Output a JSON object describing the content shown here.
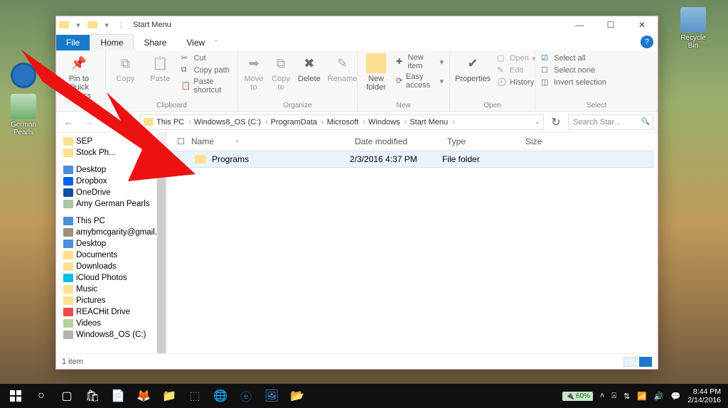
{
  "desktop": {
    "recycle": "Recycle Bin",
    "german_pearls": "German Pearls"
  },
  "window": {
    "title": "Start Menu",
    "tabs": {
      "file": "File",
      "home": "Home",
      "share": "Share",
      "view": "View"
    },
    "ribbon": {
      "pin": "Pin to Quick access",
      "copy": "Copy",
      "paste": "Paste",
      "cut": "Cut",
      "copypath": "Copy path",
      "pasteshort": "Paste shortcut",
      "clipboard": "Clipboard",
      "moveto": "Move to",
      "copyto": "Copy to",
      "delete": "Delete",
      "rename": "Rename",
      "organize": "Organize",
      "newfolder": "New folder",
      "newitem": "New item",
      "easyaccess": "Easy access",
      "new": "New",
      "properties": "Properties",
      "open": "Open",
      "edit": "Edit",
      "history": "History",
      "opengrp": "Open",
      "selectall": "Select all",
      "selectnone": "Select none",
      "invert": "Invert selection",
      "select": "Select"
    },
    "breadcrumbs": [
      "This PC",
      "Windows8_OS (C:)",
      "ProgramData",
      "Microsoft",
      "Windows",
      "Start Menu"
    ],
    "refresh_hint": "↻",
    "search_placeholder": "Search Star...",
    "columns": {
      "name": "Name",
      "date": "Date modified",
      "type": "Type",
      "size": "Size"
    },
    "rows": [
      {
        "name": "Programs",
        "date": "2/3/2016 4:37 PM",
        "type": "File folder",
        "size": ""
      }
    ],
    "status": "1 item"
  },
  "tree": [
    {
      "cls": "fld",
      "ind": 1,
      "label": "SEP"
    },
    {
      "cls": "fld",
      "ind": 1,
      "label": "Stock Ph..."
    },
    {
      "cls": "pc",
      "ind": 0,
      "label": "Desktop"
    },
    {
      "cls": "db",
      "ind": 1,
      "label": "Dropbox"
    },
    {
      "cls": "od",
      "ind": 1,
      "label": "OneDrive"
    },
    {
      "cls": "user",
      "ind": 1,
      "label": "Amy German Pearls"
    },
    {
      "cls": "pc",
      "ind": 1,
      "label": "This PC"
    },
    {
      "cls": "mail",
      "ind": 2,
      "label": "amybmcgarity@gmail.com"
    },
    {
      "cls": "pc",
      "ind": 2,
      "label": "Desktop"
    },
    {
      "cls": "fld",
      "ind": 2,
      "label": "Documents"
    },
    {
      "cls": "fld",
      "ind": 2,
      "label": "Downloads"
    },
    {
      "cls": "ic",
      "ind": 2,
      "label": "iCloud Photos"
    },
    {
      "cls": "fld",
      "ind": 2,
      "label": "Music"
    },
    {
      "cls": "fld",
      "ind": 2,
      "label": "Pictures"
    },
    {
      "cls": "reach",
      "ind": 2,
      "label": "REACHit Drive"
    },
    {
      "cls": "vid",
      "ind": 2,
      "label": "Videos"
    },
    {
      "cls": "hd",
      "ind": 2,
      "label": "Windows8_OS (C:)"
    }
  ],
  "taskbar": {
    "battery": "60%",
    "time": "8:44 PM",
    "date": "2/14/2016"
  }
}
